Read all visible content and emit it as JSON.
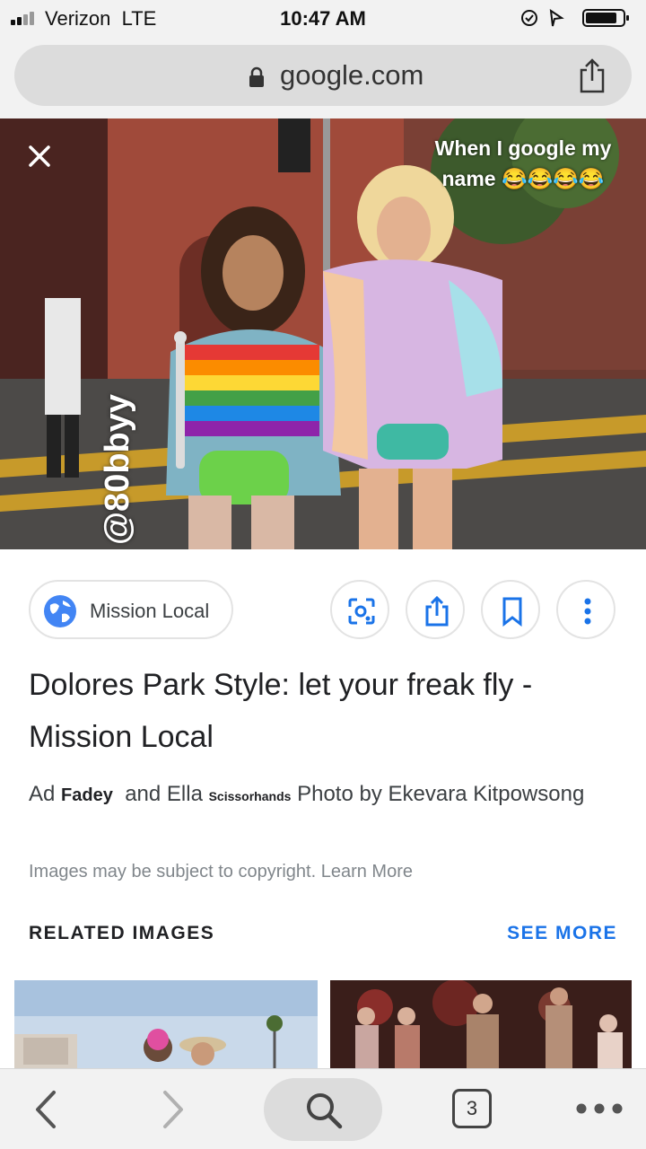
{
  "status_bar": {
    "carrier": "Verizon",
    "network": "LTE",
    "time": "10:47 AM"
  },
  "browser": {
    "url": "google.com"
  },
  "story": {
    "caption": "When I google my name 😂😂😂😂",
    "handle": "@80bbyy"
  },
  "result": {
    "source": "Mission Local",
    "title": "Dolores Park Style: let your freak fly - Mission Local",
    "caption_prefix": "Ad",
    "caption_name1": "Fadey",
    "caption_mid": "and Ella",
    "caption_name2": "Scissorhands",
    "caption_suffix": "Photo by Ekevara Kitpowsong",
    "copyright": "Images may be subject to copyright. Learn More"
  },
  "related": {
    "label": "RELATED IMAGES",
    "see_more": "SEE MORE"
  },
  "toolbar": {
    "tab_count": "3"
  },
  "colors": {
    "accent": "#1a73e8",
    "chrome_bg": "#f2f2f2"
  },
  "icons": [
    "signal-icon",
    "lock-icon",
    "share-icon",
    "close-icon",
    "globe-icon",
    "lens-icon",
    "share-icon",
    "bookmark-icon",
    "more-vert-icon",
    "back-icon",
    "forward-icon",
    "search-icon",
    "more-horiz-icon"
  ]
}
